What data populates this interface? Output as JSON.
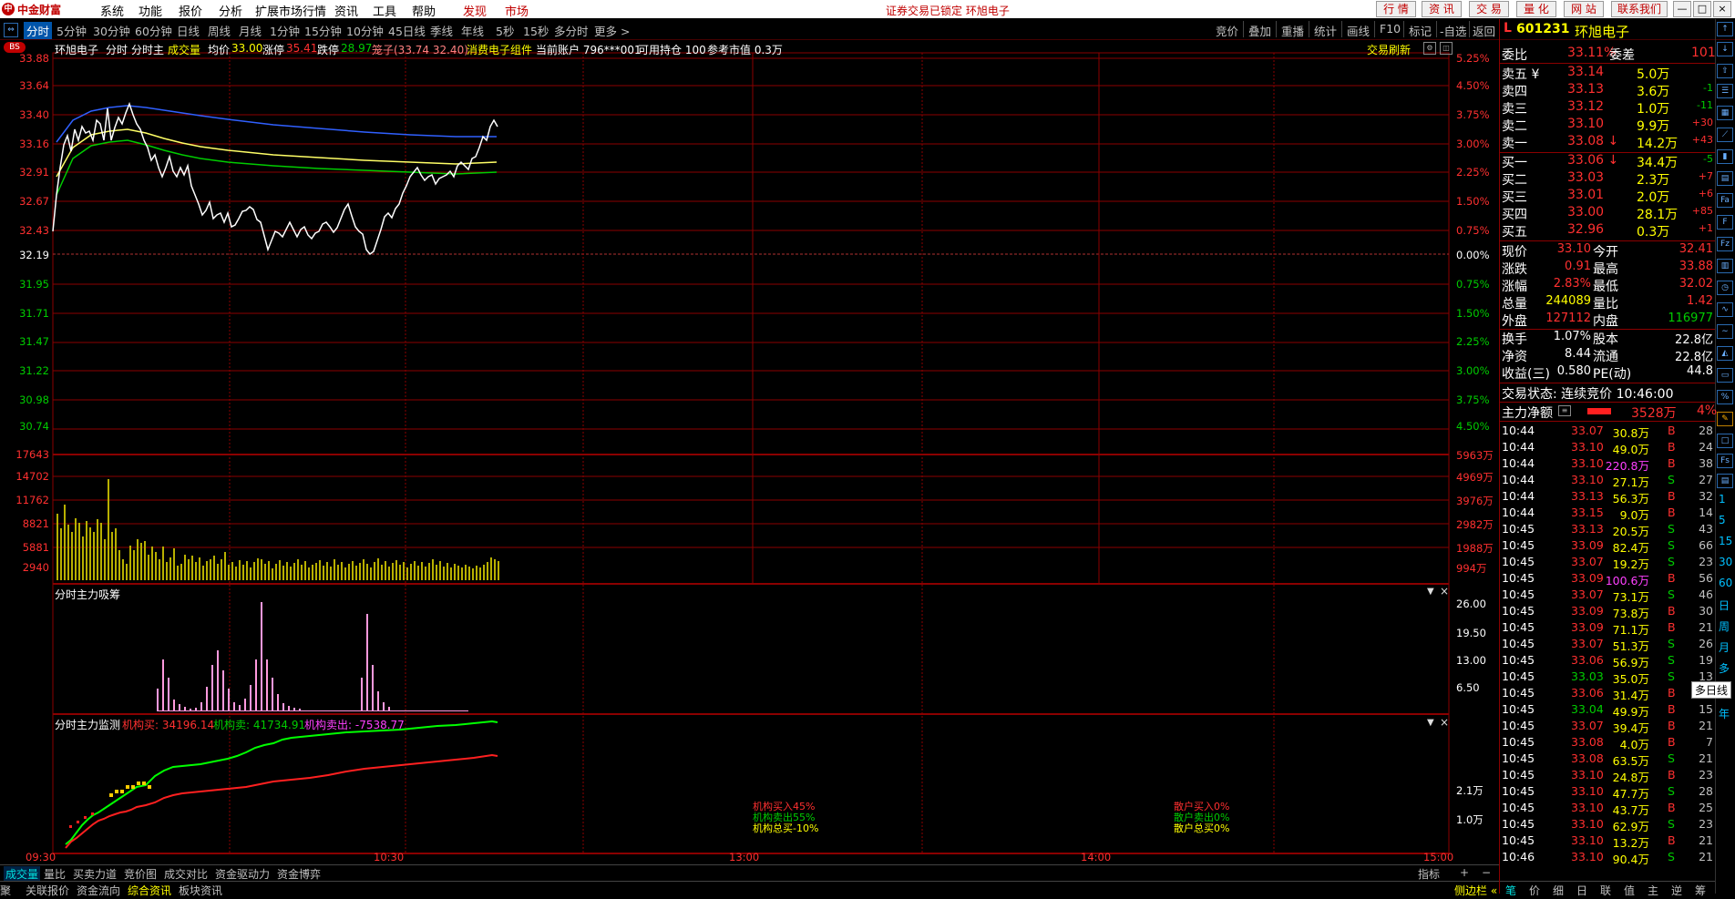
{
  "app": {
    "logo_text": "中金财富",
    "logo_mark": "中"
  },
  "menu": [
    "系统",
    "功能",
    "报价",
    "分析",
    "扩展市场行情",
    "资讯",
    "工具",
    "帮助"
  ],
  "menu_red": [
    "发现",
    "市场"
  ],
  "lock_message": "证券交易已锁定 环旭电子",
  "top_buttons": [
    "行 情",
    "资 讯",
    "交 易",
    "量 化",
    "网 站",
    "联系我们"
  ],
  "window_buttons": [
    "—",
    "□",
    "×"
  ],
  "periods": [
    "分时",
    "5分钟",
    "30分钟",
    "60分钟",
    "日线",
    "周线",
    "月线",
    "1分钟",
    "15分钟",
    "10分钟",
    "45日线",
    "季线",
    "年线",
    "5秒",
    "15秒",
    "多分时",
    "更多 >"
  ],
  "right_tools": [
    "竞价",
    "叠加",
    "重播",
    "统计",
    "画线",
    "F10",
    "标记",
    "-自选",
    "返回"
  ],
  "chart_header": {
    "badge": "BS",
    "stock": "环旭电子",
    "tab1": "分时",
    "tab2": "分时主",
    "vol": "成交量",
    "avg_label": "均价",
    "avg_val": "33.00",
    "up_label": "涨停",
    "up_val": "35.41",
    "down_label": "跌停",
    "down_val": "28.97",
    "cage": "笼子(33.74 32.40)",
    "group": "消费电子组件",
    "account": "当前账户 796***001",
    "avail": "可用持仓 100",
    "ref": "参考市值 0.3万",
    "refresh": "交易刷新"
  },
  "price_axis_left": [
    "33.88",
    "33.64",
    "33.40",
    "33.16",
    "32.91",
    "32.67",
    "32.43",
    "32.19",
    "31.95",
    "31.71",
    "31.47",
    "31.22",
    "30.98",
    "30.74"
  ],
  "price_axis_right": [
    "5.25%",
    "4.50%",
    "3.75%",
    "3.00%",
    "2.25%",
    "1.50%",
    "0.75%",
    "0.00%",
    "0.75%",
    "1.50%",
    "2.25%",
    "3.00%",
    "3.75%",
    "4.50%"
  ],
  "vol_axis_left": [
    "17643",
    "14702",
    "11762",
    "8821",
    "5881",
    "2940"
  ],
  "vol_axis_right": [
    "5963万",
    "4969万",
    "3976万",
    "2982万",
    "1988万",
    "994万"
  ],
  "panel2": {
    "title": "分时主力吸筹",
    "axis": [
      "26.00",
      "19.50",
      "13.00",
      "6.50"
    ]
  },
  "panel3": {
    "title": "分时主力监测",
    "buy": "机构买: 34196.14",
    "sell": "机构卖: 41734.91",
    "net": "机构卖出: -7538.77",
    "axis": [
      "2.1万",
      "1.0万"
    ],
    "stats_left": [
      "机构买入45%",
      "机构卖出55%",
      "机构总买-10%"
    ],
    "stats_right": [
      "散户买入0%",
      "散户卖出0%",
      "散户总买0%"
    ]
  },
  "time_axis": [
    "09:30",
    "10:30",
    "13:00",
    "14:00",
    "15:00"
  ],
  "bottom_tabs": [
    "成交量",
    "量比",
    "买卖力道",
    "竞价图",
    "成交对比",
    "资金驱动力",
    "资金博弈"
  ],
  "bottom_tabs2": [
    "关联报价",
    "资金流向",
    "综合资讯",
    "板块资讯"
  ],
  "bottom_left_cut": "聚",
  "indicator_btn": "指标",
  "plus_minus": [
    "+",
    "−"
  ],
  "quote": {
    "code": "601231",
    "name": "环旭电子",
    "level": "L",
    "wb_label": "委比",
    "wb": "33.11%",
    "wc_label": "委差",
    "wc": "101",
    "asks": [
      {
        "label": "卖五 ¥",
        "price": "33.14",
        "vol": "5.0万",
        "chg": ""
      },
      {
        "label": "卖四",
        "price": "33.13",
        "vol": "3.6万",
        "chg": "-1"
      },
      {
        "label": "卖三",
        "price": "33.12",
        "vol": "1.0万",
        "chg": "-11"
      },
      {
        "label": "卖二",
        "price": "33.10",
        "vol": "9.9万",
        "chg": "+30"
      },
      {
        "label": "卖一",
        "price": "33.08 ↓",
        "vol": "14.2万",
        "chg": "+43"
      }
    ],
    "bids": [
      {
        "label": "买一",
        "price": "33.06 ↓",
        "vol": "34.4万",
        "chg": "-5"
      },
      {
        "label": "买二",
        "price": "33.03",
        "vol": "2.3万",
        "chg": "+7"
      },
      {
        "label": "买三",
        "price": "33.01",
        "vol": "2.0万",
        "chg": "+6"
      },
      {
        "label": "买四",
        "price": "33.00",
        "vol": "28.1万",
        "chg": "+85"
      },
      {
        "label": "买五",
        "price": "32.96",
        "vol": "0.3万",
        "chg": "+1"
      }
    ],
    "stats": [
      {
        "l1": "现价",
        "v1": "33.10",
        "l2": "今开",
        "v2": "32.41"
      },
      {
        "l1": "涨跌",
        "v1": "0.91",
        "l2": "最高",
        "v2": "33.88"
      },
      {
        "l1": "涨幅",
        "v1": "2.83%",
        "l2": "最低",
        "v2": "32.02"
      },
      {
        "l1": "总量",
        "v1": "244089",
        "l2": "量比",
        "v2": "1.42"
      },
      {
        "l1": "外盘",
        "v1": "127112",
        "l2": "内盘",
        "v2": "116977"
      }
    ],
    "stats2": [
      {
        "l1": "换手",
        "v1": "1.07%",
        "l2": "股本",
        "v2": "22.8亿"
      },
      {
        "l1": "净资",
        "v1": "8.44",
        "l2": "流通",
        "v2": "22.8亿"
      },
      {
        "l1": "收益(三)",
        "v1": "0.580",
        "l2": "PE(动)",
        "v2": "44.8"
      }
    ],
    "status": "交易状态: 连续竞价 10:46:00",
    "main_net_label": "主力净额",
    "main_net_val": "3528万",
    "main_net_pct": "4%"
  },
  "ticks": [
    [
      "10:44",
      "33.07",
      "30.8万",
      "B",
      "28"
    ],
    [
      "10:44",
      "33.10",
      "49.0万",
      "B",
      "24"
    ],
    [
      "10:44",
      "33.10",
      "220.8万",
      "B",
      "38"
    ],
    [
      "10:44",
      "33.10",
      "27.1万",
      "S",
      "27"
    ],
    [
      "10:44",
      "33.13",
      "56.3万",
      "B",
      "32"
    ],
    [
      "10:44",
      "33.15",
      "9.0万",
      "B",
      "14"
    ],
    [
      "10:45",
      "33.13",
      "20.5万",
      "S",
      "43"
    ],
    [
      "10:45",
      "33.09",
      "82.4万",
      "S",
      "66"
    ],
    [
      "10:45",
      "33.07",
      "19.2万",
      "S",
      "23"
    ],
    [
      "10:45",
      "33.09",
      "100.6万",
      "B",
      "56"
    ],
    [
      "10:45",
      "33.07",
      "73.1万",
      "S",
      "46"
    ],
    [
      "10:45",
      "33.09",
      "73.8万",
      "B",
      "30"
    ],
    [
      "10:45",
      "33.09",
      "71.1万",
      "B",
      "21"
    ],
    [
      "10:45",
      "33.07",
      "51.3万",
      "S",
      "26"
    ],
    [
      "10:45",
      "33.06",
      "56.9万",
      "S",
      "19"
    ],
    [
      "10:45",
      "33.03",
      "35.0万",
      "S",
      "13"
    ],
    [
      "10:45",
      "33.06",
      "31.4万",
      "B",
      "5"
    ],
    [
      "10:45",
      "33.04",
      "49.9万",
      "B",
      "15"
    ],
    [
      "10:45",
      "33.07",
      "39.4万",
      "B",
      "21"
    ],
    [
      "10:45",
      "33.08",
      "4.0万",
      "B",
      "7"
    ],
    [
      "10:45",
      "33.08",
      "63.5万",
      "S",
      "21"
    ],
    [
      "10:45",
      "33.10",
      "24.8万",
      "B",
      "23"
    ],
    [
      "10:45",
      "33.10",
      "47.7万",
      "S",
      "28"
    ],
    [
      "10:45",
      "33.10",
      "43.7万",
      "B",
      "25"
    ],
    [
      "10:45",
      "33.10",
      "62.9万",
      "S",
      "23"
    ],
    [
      "10:45",
      "33.10",
      "13.2万",
      "B",
      "21"
    ],
    [
      "10:46",
      "33.10",
      "90.4万",
      "S",
      "21"
    ]
  ],
  "right_tabs": [
    "笔",
    "价",
    "细",
    "日",
    "联",
    "值",
    "主",
    "逆",
    "筹"
  ],
  "side_panel": "侧边栏 «",
  "side_tooltip": "多日线",
  "side_labels": [
    "1",
    "5",
    "15",
    "30",
    "60",
    "日",
    "周",
    "月",
    "多",
    "年"
  ],
  "colors": {
    "up": "#ff3030",
    "down": "#00cc00",
    "grid": "#8b0000",
    "bg": "#000000",
    "accent": "#00e0e0"
  }
}
